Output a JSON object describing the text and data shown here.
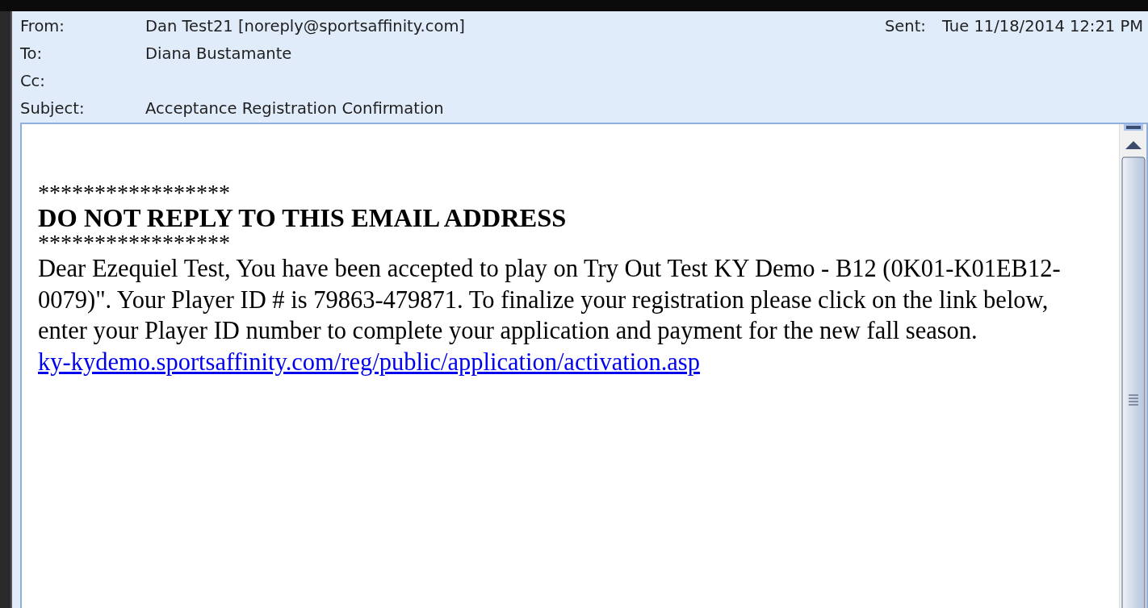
{
  "header": {
    "fields": [
      {
        "label": "From:",
        "value": "Dan Test21 [noreply@sportsaffinity.com]"
      },
      {
        "label": "To:",
        "value": "Diana Bustamante"
      },
      {
        "label": "Cc:"
      },
      {
        "label": "Subject:",
        "value": "Acceptance Registration Confirmation"
      }
    ],
    "sent": {
      "label": "Sent:",
      "value": "Tue 11/18/2014 12:21 PM"
    }
  },
  "body": {
    "rule_top": "*****************",
    "heading": "DO NOT REPLY TO THIS EMAIL ADDRESS",
    "rule_bottom": "*****************",
    "message": "Dear Ezequiel Test, You have been accepted to play on Try Out Test KY Demo - B12 (0K01-K01EB12-0079)\". Your Player ID # is 79863-479871. To finalize your registration please click on the link below, enter your Player ID number to complete your application and payment for the new fall season.",
    "link": "ky-kydemo.sportsaffinity.com/reg/public/application/activation.asp"
  }
}
